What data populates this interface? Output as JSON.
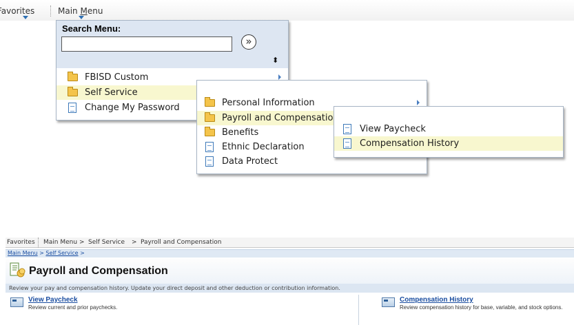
{
  "top_nav": {
    "favorites_pre": "Favorites",
    "main_menu_pre": "Main ",
    "main_menu_u": "M",
    "main_menu_post": "enu"
  },
  "search_panel": {
    "label": "Search Menu:",
    "input_value": "",
    "go_symbol": "»",
    "sort_symbol": "⬍"
  },
  "menu_level1": [
    {
      "label": "FBISD Custom",
      "icon": "folder-icon",
      "has_submenu": true
    },
    {
      "label": "Self Service",
      "icon": "folder-icon",
      "highlighted": true
    },
    {
      "label": "Change My Password",
      "icon": "document-icon"
    }
  ],
  "menu_level2": [
    {
      "label": "Personal Information",
      "icon": "folder-icon",
      "has_submenu": true
    },
    {
      "label": "Payroll and Compensation",
      "icon": "folder-icon",
      "highlighted": true
    },
    {
      "label": "Benefits",
      "icon": "folder-icon"
    },
    {
      "label": "Ethnic Declaration",
      "icon": "document-icon"
    },
    {
      "label": "Data Protect",
      "icon": "document-icon"
    }
  ],
  "menu_level3": [
    {
      "label": "View Paycheck",
      "icon": "document-icon"
    },
    {
      "label": "Compensation History",
      "icon": "document-icon",
      "highlighted": true
    }
  ],
  "bottom_nav": {
    "favorites": "Favorites",
    "main_menu": "Main Menu",
    "self_service": "Self Service",
    "payroll": "Payroll and Compensation",
    "sep": ">"
  },
  "crumbs": {
    "main_menu": "Main Menu",
    "self_service": "Self Service",
    "sep": ">"
  },
  "page": {
    "title": "Payroll and Compensation",
    "description": "Review your pay and compensation history. Update your direct deposit and other deduction or contribution information."
  },
  "tiles": [
    {
      "title": "View Paycheck",
      "desc": "Review current and prior paychecks."
    },
    {
      "title": "Compensation History",
      "desc": "Review compensation history for base, variable, and stock options."
    }
  ],
  "colors": {
    "highlight": "#f8f7cf",
    "panel_header": "#dde6f2",
    "link": "#1a4da0"
  }
}
